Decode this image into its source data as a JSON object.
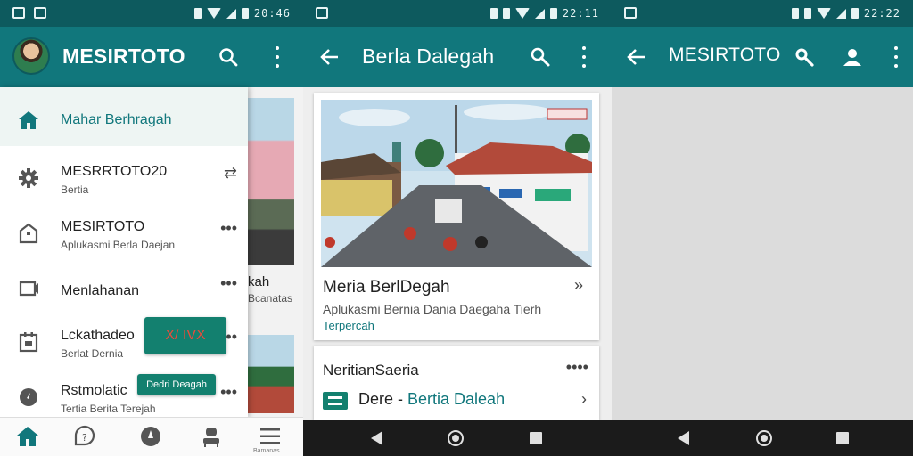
{
  "screens": [
    {
      "statusbar": {
        "time": "20:46"
      },
      "appbar": {
        "title": "MESIRTOTO",
        "icons": [
          "avatar",
          "search-icon",
          "more-vert-icon"
        ]
      },
      "drawer": {
        "active_item": {
          "label": "Mahar Berhragah",
          "icon": "home-icon"
        },
        "items": [
          {
            "title": "MESRRTOTO20",
            "subtitle": "Bertia",
            "icon": "settings-icon",
            "more": "⇄"
          },
          {
            "title": "MESIRTOTO",
            "subtitle": "Aplukasmi Berla Daejan",
            "icon": "home-outline-icon",
            "more": "•••"
          },
          {
            "title": "Menlahanan",
            "subtitle": "",
            "icon": "message-icon",
            "more": "•••"
          },
          {
            "title": "Lckathadeo",
            "subtitle": "Berlat Dernia",
            "icon": "calendar-icon",
            "more": "•••"
          },
          {
            "title": "Rstmolatic",
            "subtitle": "Tertia Berita Terejah",
            "icon": "compass-icon",
            "more": "•••"
          }
        ],
        "chips": {
          "chip1": "X/ IVX",
          "chip2": "Dedri Deagah"
        }
      },
      "behind": {
        "text1": "kah",
        "text2": "Bcanatas"
      },
      "bottomnav": {
        "items": [
          "home-icon",
          "help-icon",
          "explore-icon",
          "people-icon",
          "menu-icon"
        ],
        "last_label": "Bamanas"
      }
    },
    {
      "statusbar": {
        "time": "22:11"
      },
      "appbar": {
        "title": "Berla Dalegah"
      },
      "card1": {
        "photo_badge": "",
        "title": "Meria BerlDegah",
        "subtitle": "Aplukasmi Bernia Dania Daegaha Tierh",
        "source": "Terpercah",
        "chevron": "»"
      },
      "card2": {
        "heading": "NeritianSaeria",
        "more": "••••",
        "row_text": "Dere",
        "row_sep": " - ",
        "row_highlight": "Bertia Daleah",
        "chevron": "›"
      }
    },
    {
      "statusbar": {
        "time": "22:22"
      },
      "appbar": {
        "title": "MESIRTOTO"
      }
    }
  ],
  "colors": {
    "primary": "#11777c",
    "status": "#0d5a5e",
    "accent": "#13806f"
  }
}
